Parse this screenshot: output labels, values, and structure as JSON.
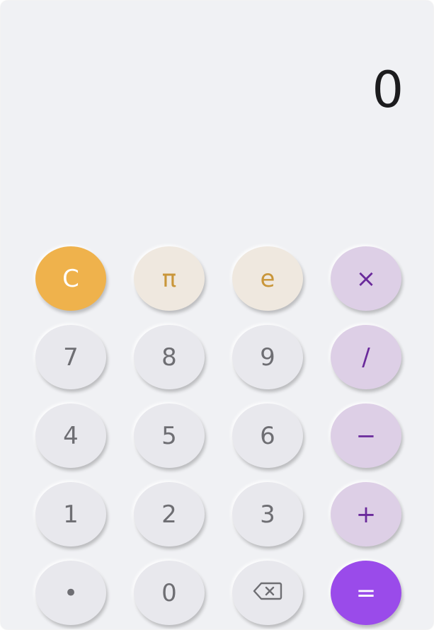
{
  "display": {
    "value": "0"
  },
  "keys": [
    {
      "label": "C",
      "name": "clear-button",
      "kind": "clear"
    },
    {
      "label": "π",
      "name": "pi-button",
      "kind": "const"
    },
    {
      "label": "e",
      "name": "euler-button",
      "kind": "const"
    },
    {
      "label": "×",
      "name": "multiply-button",
      "kind": "op"
    },
    {
      "label": "7",
      "name": "digit-7-button",
      "kind": "digit"
    },
    {
      "label": "8",
      "name": "digit-8-button",
      "kind": "digit"
    },
    {
      "label": "9",
      "name": "digit-9-button",
      "kind": "digit"
    },
    {
      "label": "/",
      "name": "divide-button",
      "kind": "op"
    },
    {
      "label": "4",
      "name": "digit-4-button",
      "kind": "digit"
    },
    {
      "label": "5",
      "name": "digit-5-button",
      "kind": "digit"
    },
    {
      "label": "6",
      "name": "digit-6-button",
      "kind": "digit"
    },
    {
      "label": "−",
      "name": "subtract-button",
      "kind": "op"
    },
    {
      "label": "1",
      "name": "digit-1-button",
      "kind": "digit"
    },
    {
      "label": "2",
      "name": "digit-2-button",
      "kind": "digit"
    },
    {
      "label": "3",
      "name": "digit-3-button",
      "kind": "digit"
    },
    {
      "label": "+",
      "name": "add-button",
      "kind": "op"
    },
    {
      "label": "•",
      "name": "decimal-point-button",
      "kind": "digit"
    },
    {
      "label": "0",
      "name": "digit-0-button",
      "kind": "digit"
    },
    {
      "label": "",
      "name": "backspace-button",
      "kind": "digit",
      "icon": "backspace-icon"
    },
    {
      "label": "=",
      "name": "equals-button",
      "kind": "equals"
    }
  ],
  "colors": {
    "background": "#f0f1f4",
    "clear": "#efb24c",
    "constant": "#efe8df",
    "constant_text": "#c9963a",
    "operator": "#ddcfe6",
    "operator_text": "#6a2a9b",
    "equals": "#9a4bea",
    "digit": "#e8e8ed",
    "digit_text": "#6e6e73"
  }
}
